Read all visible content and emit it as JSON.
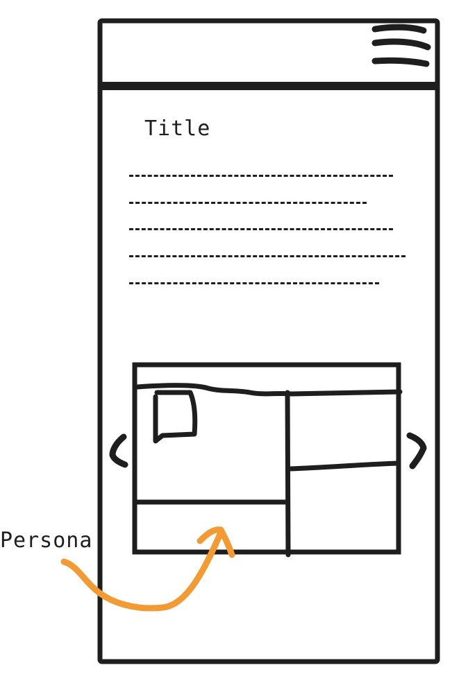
{
  "content": {
    "title": "Title",
    "text_line_count": 5
  },
  "annotation": {
    "label": "Persona",
    "arrow_color": "#f29b34"
  },
  "stroke_color": "#1e1e1e",
  "icons": {
    "menu": "hamburger-menu-icon",
    "prev": "chevron-left-icon",
    "next": "chevron-right-icon"
  }
}
